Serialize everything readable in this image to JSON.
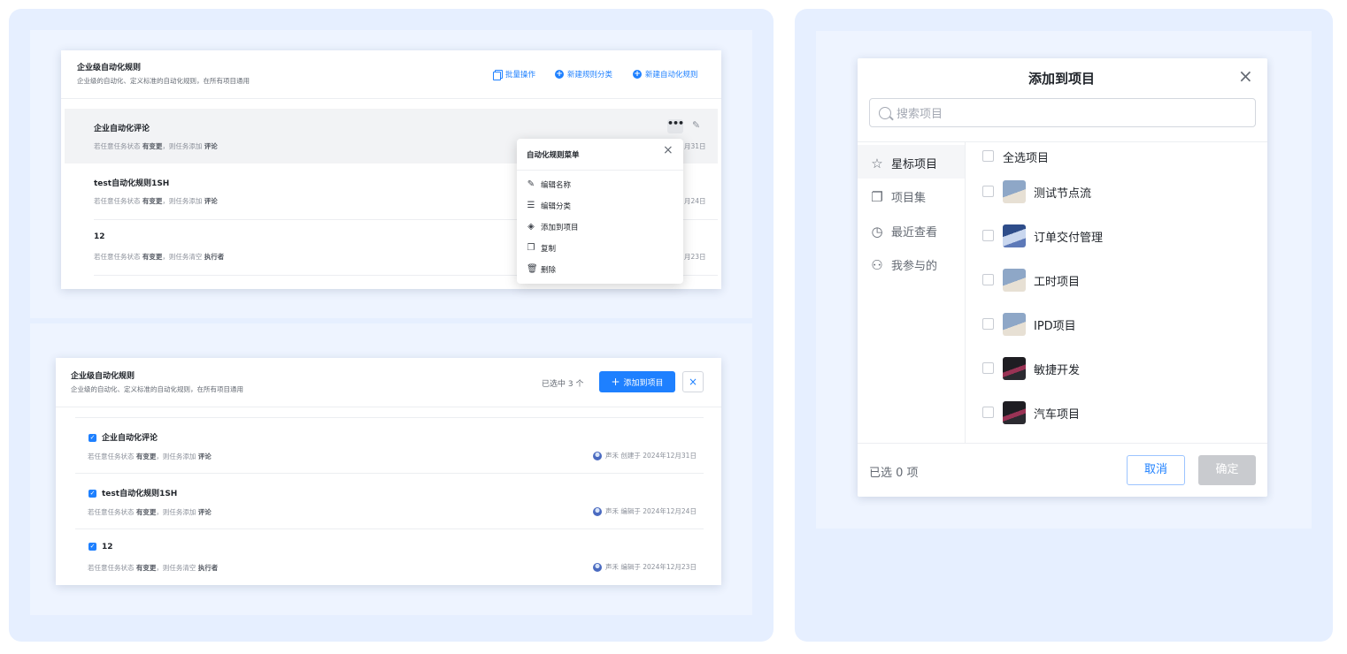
{
  "rules_page": {
    "title": "企业级自动化规则",
    "subtitle": "企业级的自动化、定义标准的自动化规则，在所有项目通用",
    "actions": {
      "batch": "批量操作",
      "new_category": "新建规则分类",
      "new_rule": "新建自动化规则"
    },
    "rules": [
      {
        "name": "企业自动化评论",
        "desc_prefix": "若任意任务状态",
        "desc_mid": "有变更",
        "desc_joiner": "，则任务添加",
        "desc_target": "评论",
        "date": "月31日"
      },
      {
        "name": "test自动化规则1SH",
        "desc_prefix": "若任意任务状态",
        "desc_mid": "有变更",
        "desc_joiner": "，则任务添加",
        "desc_target": "评论",
        "date": "月24日"
      },
      {
        "name": "12",
        "desc_prefix": "若任意任务状态",
        "desc_mid": "有变更",
        "desc_joiner": "，则任务清空",
        "desc_target": "执行者",
        "date": "月23日"
      }
    ],
    "more_icon": "•••",
    "menu": {
      "title": "自动化规则菜单",
      "items": [
        {
          "label": "编辑名称",
          "icon": "edit-doc-icon"
        },
        {
          "label": "编辑分类",
          "icon": "list-icon"
        },
        {
          "label": "添加到项目",
          "icon": "layers-icon"
        },
        {
          "label": "复制",
          "icon": "copy-icon"
        },
        {
          "label": "删除",
          "icon": "trash-icon"
        }
      ]
    }
  },
  "batch_page": {
    "title": "企业级自动化规则",
    "subtitle": "企业级的自动化、定义标准的自动化规则，在所有项目通用",
    "selected_text": "已选中 3 个",
    "add_button": "添加到项目",
    "rules": [
      {
        "name": "企业自动化评论",
        "desc_prefix": "若任意任务状态",
        "desc_mid": "有变更",
        "desc_joiner": "，则任务添加",
        "desc_target": "评论",
        "meta": "声禾 创建于 2024年12月31日"
      },
      {
        "name": "test自动化规则1SH",
        "desc_prefix": "若任意任务状态",
        "desc_mid": "有变更",
        "desc_joiner": "，则任务添加",
        "desc_target": "评论",
        "meta": "声禾 编辑于 2024年12月24日"
      },
      {
        "name": "12",
        "desc_prefix": "若任意任务状态",
        "desc_mid": "有变更",
        "desc_joiner": "，则任务清空",
        "desc_target": "执行者",
        "meta": "声禾 编辑于 2024年12月23日"
      }
    ]
  },
  "dialog": {
    "title": "添加到项目",
    "search_placeholder": "搜索项目",
    "sidebar": [
      {
        "label": "星标项目",
        "icon": "star-icon"
      },
      {
        "label": "项目集",
        "icon": "collection-icon"
      },
      {
        "label": "最近查看",
        "icon": "clock-icon"
      },
      {
        "label": "我参与的",
        "icon": "user-icon"
      }
    ],
    "select_all": "全选项目",
    "projects": [
      {
        "name": "测试节点流"
      },
      {
        "name": "订单交付管理"
      },
      {
        "name": "工时项目"
      },
      {
        "name": "IPD项目"
      },
      {
        "name": "敏捷开发"
      },
      {
        "name": "汽车项目"
      }
    ],
    "selected_count": "已选 0 项",
    "cancel": "取消",
    "confirm": "确定"
  },
  "colors": {
    "accent": "#1e80ff",
    "panel_bg": "#e6efff",
    "disabled_btn": "#c9cbcf"
  }
}
